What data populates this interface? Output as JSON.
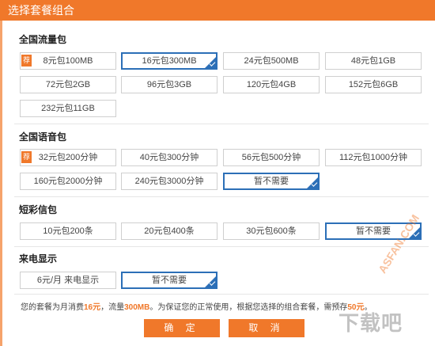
{
  "dialog": {
    "title": "选择套餐组合"
  },
  "badge_text": "荐",
  "colors": {
    "accent": "#f0782a",
    "selected_border": "#2c6fb7"
  },
  "sections": {
    "data": {
      "title": "全国流量包",
      "options": [
        "8元包100MB",
        "16元包300MB",
        "24元包500MB",
        "48元包1GB",
        "72元包2GB",
        "96元包3GB",
        "120元包4GB",
        "152元包6GB",
        "232元包11GB"
      ],
      "recommended_index": 0,
      "selected_index": 1
    },
    "voice": {
      "title": "全国语音包",
      "options": [
        "32元包200分钟",
        "40元包300分钟",
        "56元包500分钟",
        "112元包1000分钟",
        "160元包2000分钟",
        "240元包3000分钟",
        "暂不需要"
      ],
      "recommended_index": 0,
      "selected_index": 6
    },
    "sms": {
      "title": "短彩信包",
      "options": [
        "10元包200条",
        "20元包400条",
        "30元包600条",
        "暂不需要"
      ],
      "selected_index": 3
    },
    "caller_id": {
      "title": "来电显示",
      "options": [
        "6元/月 来电显示",
        "暂不需要"
      ],
      "selected_index": 1
    }
  },
  "notice": {
    "prefix": "您的套餐为月消费",
    "monthly_fee": "16元",
    "middle": "，流量",
    "traffic": "300MB",
    "suffix": "。为保证您的正常使用，根据您选择的组合套餐，需预存",
    "prepay": "50元",
    "end": "。"
  },
  "buttons": {
    "confirm": "确 定",
    "cancel": "取 消"
  },
  "watermark": "ASFAN.COM",
  "logo_mark": "下载吧"
}
